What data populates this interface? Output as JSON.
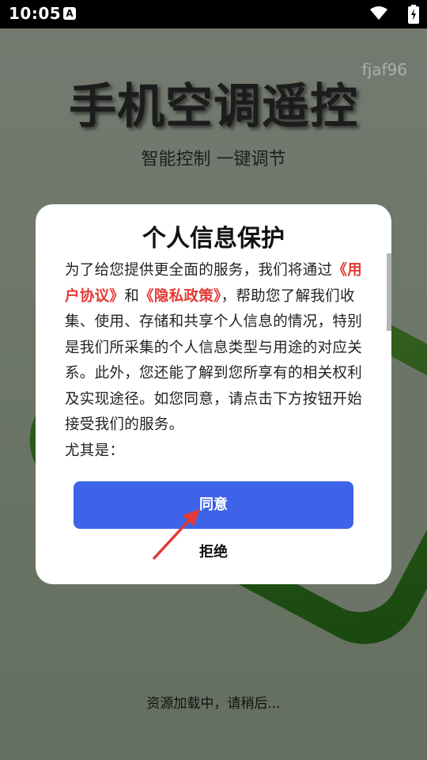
{
  "status_bar": {
    "time": "10:05",
    "notification_icon_letter": "A",
    "icons": [
      "a-notification-icon",
      "wifi-icon",
      "battery-charging-icon"
    ]
  },
  "app": {
    "watermark": "fjaf96",
    "title": "手机空调遥控",
    "subtitle": "智能控制 一键调节",
    "loading_text": "资源加载中，请稍后..."
  },
  "dialog": {
    "title": "个人信息保护",
    "body": {
      "intro": "为了给您提供更全面的服务，我们将通过",
      "link1": "《用户协议》",
      "conj": "和",
      "link2": "《隐私政策》",
      "rest": "，帮助您了解我们收集、使用、存储和共享个人信息的情况，特别是我们所采集的个人信息类型与用途的对应关系。此外，您还能了解到您所享有的相关权利及实现途径。如您同意，请点击下方按钮开始接受我们的服务。",
      "cut_line": "尤其是："
    },
    "agree_label": "同意",
    "refuse_label": "拒绝"
  },
  "colors": {
    "link": "#e53935",
    "agree_button": "#3d63e8",
    "arrow": "#e53935"
  }
}
